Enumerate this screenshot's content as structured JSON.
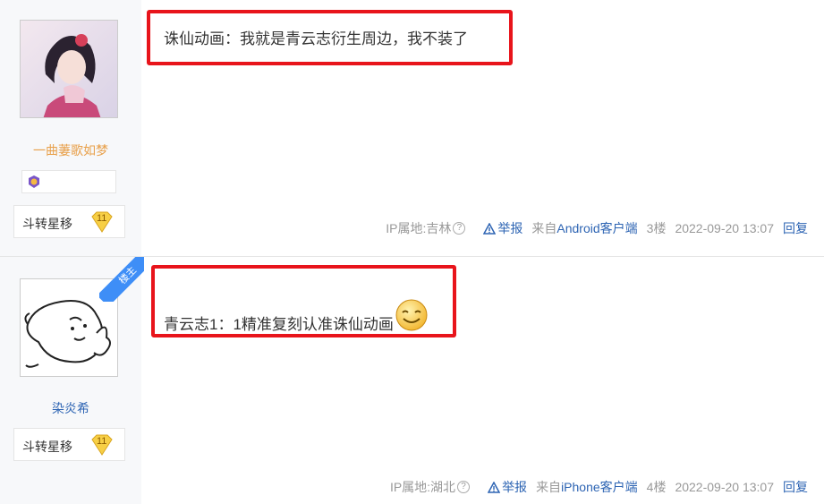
{
  "posts": [
    {
      "username": "一曲萋歌如梦",
      "level_name": "斗转星移",
      "level_number": "11",
      "content": "诛仙动画：我就是青云志衍生周边，我不装了",
      "ip": "IP属地:吉林",
      "report": "举报",
      "client": "来自Android客户端",
      "floor": "3楼",
      "time": "2022-09-20 13:07",
      "reply": "回复"
    },
    {
      "username": "染炎希",
      "level_name": "斗转星移",
      "level_number": "11",
      "ribbon": "楼主",
      "content": "青云志1：1精准复刻认准诛仙动画",
      "ip": "IP属地:湖北",
      "report": "举报",
      "client": "来自iPhone客户端",
      "floor": "4楼",
      "time": "2022-09-20 13:07",
      "reply": "回复"
    }
  ],
  "colors": {
    "link": "#2d64b3",
    "highlight": "#e8141b",
    "ribbon": "#3e8ef7",
    "username1": "#e8a04a",
    "username2": "#2d64b3"
  }
}
